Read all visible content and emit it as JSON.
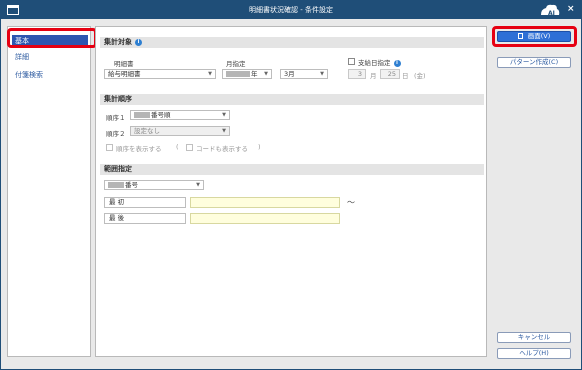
{
  "window": {
    "title": "明細書状況確認 - 条件設定",
    "close_glyph": "×",
    "logo_text": "AI"
  },
  "sidebar": {
    "items": [
      {
        "label": "基本",
        "active": true
      },
      {
        "label": "詳細",
        "active": false
      },
      {
        "label": "付箋検索",
        "active": false
      }
    ]
  },
  "aggregate": {
    "heading": "集計対象",
    "statement_label": "明細書",
    "statement_value": "給与明細書",
    "month_label": "月指定",
    "year_suffix": "年",
    "month_value": "3月",
    "payday_label": "支給日指定",
    "payday_month": "3",
    "payday_month_unit": "月",
    "payday_day": "25",
    "payday_day_unit": "日",
    "payday_weekday": "(金)"
  },
  "order": {
    "heading": "集計順序",
    "order1_label": "順序１",
    "order1_value": "番号順",
    "order2_label": "順序２",
    "order2_value": "設定なし",
    "show_order_label": "順序を表示する",
    "paren_open": "(",
    "show_code_label": "コードも表示する",
    "paren_close": ")"
  },
  "range": {
    "heading": "範囲指定",
    "field_value": "番号",
    "start_label": "最 初",
    "end_label": "最 後",
    "tilde": "～"
  },
  "actions": {
    "screen_button": "画面(V)",
    "pattern_button": "パターン作成(C)",
    "cancel_button": "キャンセル",
    "help_button": "ヘルプ(H)"
  },
  "colors": {
    "titlebar": "#1f4e78",
    "accent": "#2e56b0",
    "highlight": "#e60012",
    "input_highlight": "#fffedd"
  }
}
